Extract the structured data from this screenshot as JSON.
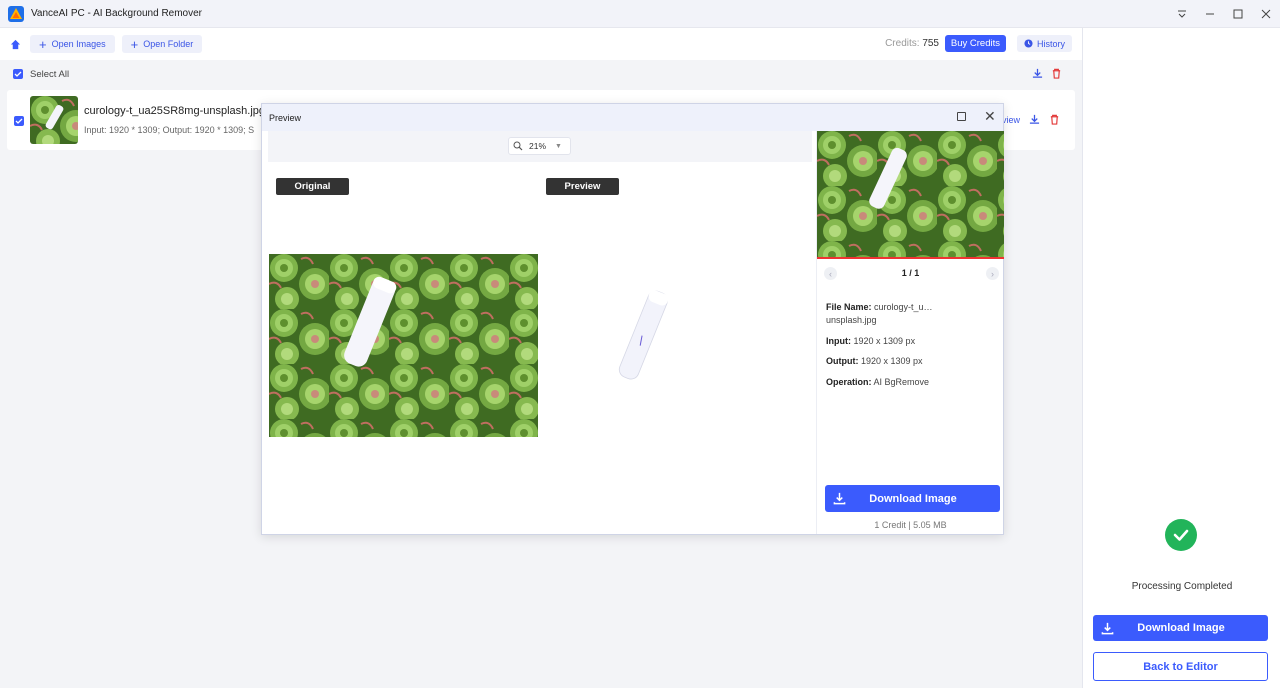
{
  "app": {
    "title": "VanceAI PC - AI Background Remover"
  },
  "toolbar": {
    "open_images": "Open Images",
    "open_folder": "Open Folder",
    "credits_label": "Credits:",
    "credits_value": "755",
    "buy_credits": "Buy Credits",
    "history": "History"
  },
  "selectbar": {
    "select_all": "Select All"
  },
  "file": {
    "name": "curology-t_ua25SR8mg-unsplash.jpg",
    "meta": "Input: 1920 * 1309; Output: 1920 * 1309; S",
    "view_link": "view"
  },
  "modal": {
    "title": "Preview",
    "zoom": "21%",
    "tag_original": "Original",
    "tag_preview": "Preview",
    "pager": "1 / 1",
    "file_name_label": "File Name:",
    "file_name_value": "curology-t_u…",
    "file_name_value2": "unsplash.jpg",
    "input_label": "Input:",
    "input_value": "1920 x 1309 px",
    "output_label": "Output:",
    "output_value": "1920 x 1309 px",
    "operation_label": "Operation:",
    "operation_value": "AI BgRemove",
    "download": "Download Image",
    "credit_info": "1 Credit | 5.05 MB"
  },
  "right_panel": {
    "status": "Processing Completed",
    "download": "Download Image",
    "back": "Back to Editor"
  },
  "colors": {
    "accent": "#3b5bfd",
    "success": "#22b45a",
    "danger": "#e33b3b"
  }
}
